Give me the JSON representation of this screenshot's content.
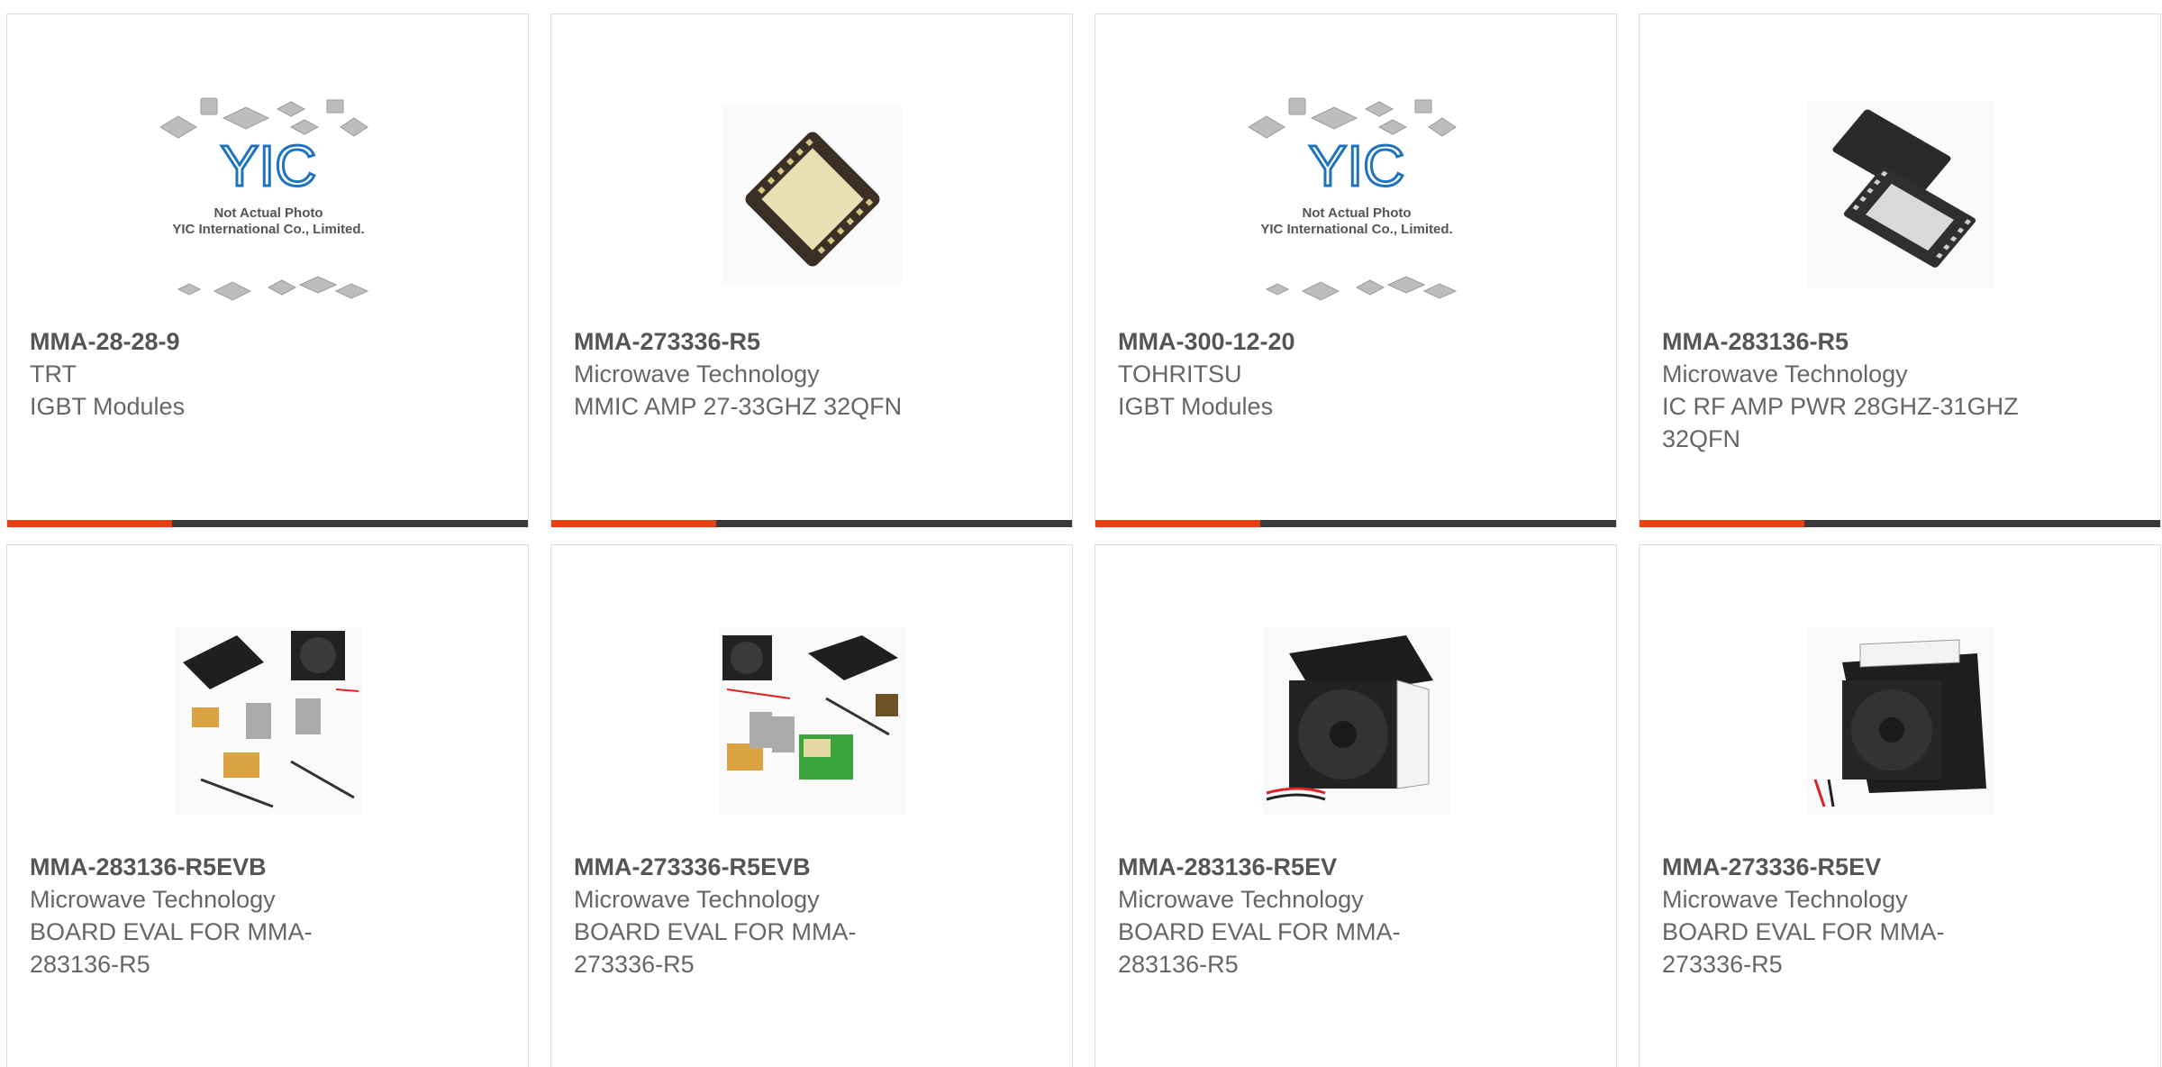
{
  "accent_color": "#e8400f",
  "bar_color": "#3a3a3a",
  "products": [
    {
      "part": "MMA-28-28-9",
      "maker": "TRT",
      "desc": "IGBT Modules",
      "image": "yic-placeholder-image",
      "placeholder_lines": [
        "Not Actual Photo",
        "YIC International Co., Limited."
      ],
      "logo": "YIC"
    },
    {
      "part": "MMA-273336-R5",
      "maker": "Microwave Technology",
      "desc": "MMIC AMP 27-33GHZ 32QFN",
      "image": "qfn-chip-gold-image"
    },
    {
      "part": "MMA-300-12-20",
      "maker": "TOHRITSU",
      "desc": "IGBT Modules",
      "image": "yic-placeholder-image",
      "placeholder_lines": [
        "Not Actual Photo",
        "YIC International Co., Limited."
      ],
      "logo": "YIC"
    },
    {
      "part": "MMA-283136-R5",
      "maker": "Microwave Technology",
      "desc": "IC RF AMP PWR 28GHZ-31GHZ 32QFN",
      "image": "qfn-chip-black-image"
    },
    {
      "part": "MMA-283136-R5EVB",
      "maker": "Microwave Technology",
      "desc": "BOARD EVAL FOR MMA-283136-R5",
      "image": "eval-kit-image"
    },
    {
      "part": "MMA-273336-R5EVB",
      "maker": "Microwave Technology",
      "desc": "BOARD EVAL FOR MMA-273336-R5",
      "image": "eval-kit-image"
    },
    {
      "part": "MMA-283136-R5EV",
      "maker": "Microwave Technology",
      "desc": "BOARD EVAL FOR MMA-283136-R5",
      "image": "heatsink-fan-image"
    },
    {
      "part": "MMA-273336-R5EV",
      "maker": "Microwave Technology",
      "desc": "BOARD EVAL FOR MMA-273336-R5",
      "image": "heatsink-fan-image"
    }
  ]
}
